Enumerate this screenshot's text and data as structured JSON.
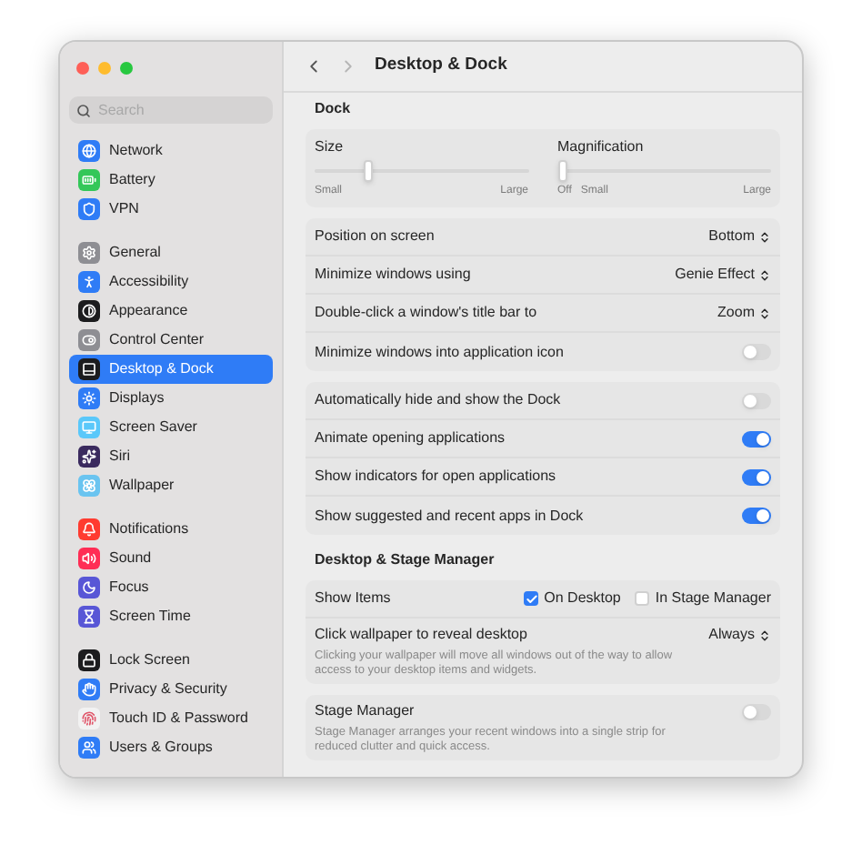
{
  "sidebar": {
    "search": {
      "placeholder": "Search"
    },
    "groups": [
      [
        {
          "label": "Network",
          "color": "#2f7cf6",
          "selected": false
        },
        {
          "label": "Battery",
          "color": "#34c759",
          "selected": false
        },
        {
          "label": "VPN",
          "color": "#2f7cf6",
          "selected": false
        }
      ],
      [
        {
          "label": "General",
          "color": "#8e8e93",
          "selected": false
        },
        {
          "label": "Accessibility",
          "color": "#2f7cf6",
          "selected": false
        },
        {
          "label": "Appearance",
          "color": "#1c1c1e",
          "selected": false
        },
        {
          "label": "Control Center",
          "color": "#8e8e93",
          "selected": false
        },
        {
          "label": "Desktop & Dock",
          "color": "#1c1c1e",
          "selected": true
        },
        {
          "label": "Displays",
          "color": "#2f7cf6",
          "selected": false
        },
        {
          "label": "Screen Saver",
          "color": "#5ac8fa",
          "selected": false
        },
        {
          "label": "Siri",
          "color": "#3a2a5e",
          "selected": false
        },
        {
          "label": "Wallpaper",
          "color": "#6ac4f0",
          "selected": false
        }
      ],
      [
        {
          "label": "Notifications",
          "color": "#ff3b30",
          "selected": false
        },
        {
          "label": "Sound",
          "color": "#ff2d55",
          "selected": false
        },
        {
          "label": "Focus",
          "color": "#5856d6",
          "selected": false
        },
        {
          "label": "Screen Time",
          "color": "#5856d6",
          "selected": false
        }
      ],
      [
        {
          "label": "Lock Screen",
          "color": "#1c1c1e",
          "selected": false
        },
        {
          "label": "Privacy & Security",
          "color": "#2f7cf6",
          "selected": false
        },
        {
          "label": "Touch ID & Password",
          "color": "#f2f2f2",
          "selected": false
        },
        {
          "label": "Users & Groups",
          "color": "#2f7cf6",
          "selected": false
        }
      ]
    ]
  },
  "toolbar": {
    "title": "Desktop & Dock"
  },
  "sections": [
    {
      "title": "Dock",
      "groups": [
        {
          "kind": "sliders",
          "sliders": [
            {
              "label": "Size",
              "level": 0.24,
              "min_label": "Small",
              "max_label": "Large"
            },
            {
              "label": "Magnification",
              "level": 0,
              "off_label": "Off",
              "min_label": "Small",
              "max_label": "Large"
            }
          ]
        },
        {
          "kind": "rows",
          "rows": [
            {
              "kind": "popup",
              "label": "Position on screen",
              "value": "Bottom"
            },
            {
              "kind": "popup",
              "label": "Minimize windows using",
              "value": "Genie Effect"
            },
            {
              "kind": "popup",
              "label": "Double-click a window's title bar to",
              "value": "Zoom"
            },
            {
              "kind": "toggle",
              "label": "Minimize windows into application icon",
              "on": false
            }
          ]
        },
        {
          "kind": "rows",
          "rows": [
            {
              "kind": "toggle",
              "label": "Automatically hide and show the Dock",
              "on": false
            },
            {
              "kind": "toggle",
              "label": "Animate opening applications",
              "on": true
            },
            {
              "kind": "toggle",
              "label": "Show indicators for open applications",
              "on": true
            },
            {
              "kind": "toggle",
              "label": "Show suggested and recent apps in Dock",
              "on": true
            }
          ]
        }
      ]
    },
    {
      "title": "Desktop & Stage Manager",
      "groups": [
        {
          "kind": "rows",
          "rows": [
            {
              "kind": "checks",
              "label": "Show Items",
              "options": [
                {
                  "label": "On Desktop",
                  "checked": true
                },
                {
                  "label": "In Stage Manager",
                  "checked": false
                }
              ]
            },
            {
              "kind": "popup",
              "label": "Click wallpaper to reveal desktop",
              "value": "Always",
              "description": "Clicking your wallpaper will move all windows out of the way to allow access to your desktop items and widgets."
            }
          ]
        },
        {
          "kind": "rows",
          "rows": [
            {
              "kind": "toggle",
              "label": "Stage Manager",
              "on": false,
              "description": "Stage Manager arranges your recent windows into a single strip for reduced clutter and quick access."
            }
          ]
        }
      ]
    }
  ]
}
